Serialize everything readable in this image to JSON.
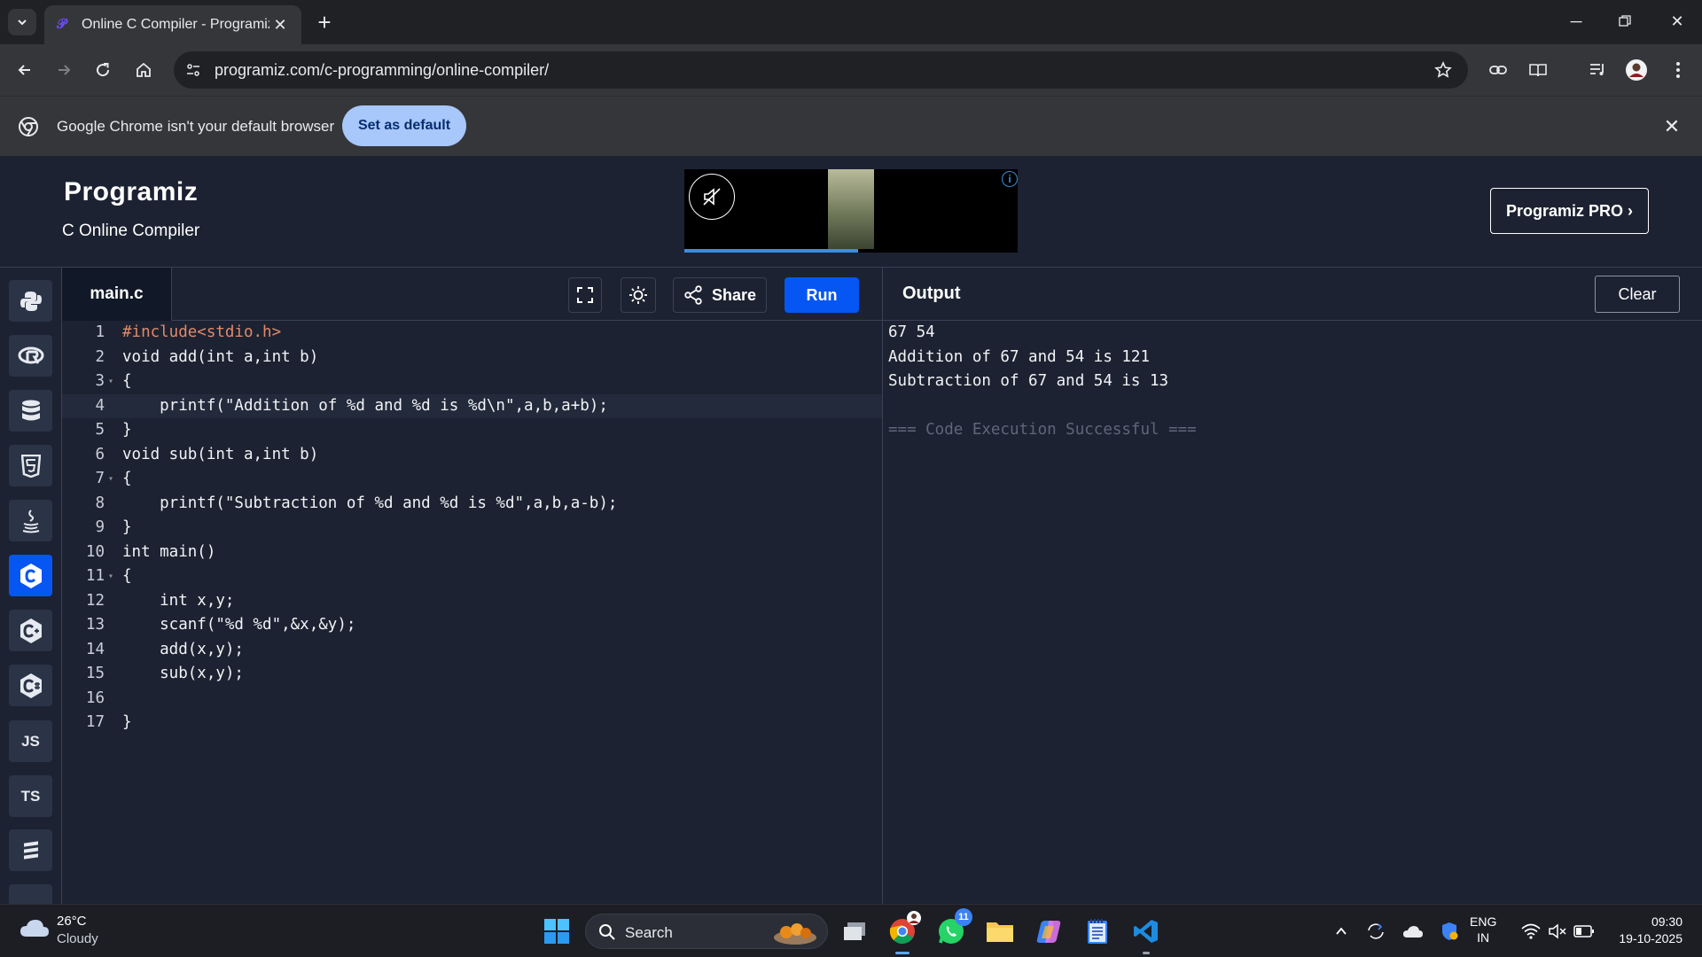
{
  "browser": {
    "tab_title": "Online C Compiler - Programiz",
    "url": "programiz.com/c-programming/online-compiler/",
    "infobar_text": "Google Chrome isn't your default browser",
    "set_default_label": "Set as default"
  },
  "site": {
    "logo": "Programiz",
    "subtitle": "C Online Compiler",
    "pro_button": "Programiz PRO ›"
  },
  "sidebar": {
    "languages": [
      {
        "name": "python",
        "label": ""
      },
      {
        "name": "r",
        "label": ""
      },
      {
        "name": "sql",
        "label": ""
      },
      {
        "name": "html",
        "label": ""
      },
      {
        "name": "java",
        "label": ""
      },
      {
        "name": "c",
        "label": "",
        "active": true
      },
      {
        "name": "cpp",
        "label": ""
      },
      {
        "name": "csharp",
        "label": ""
      },
      {
        "name": "javascript",
        "label": "JS"
      },
      {
        "name": "typescript",
        "label": "TS"
      },
      {
        "name": "more",
        "label": ""
      }
    ]
  },
  "editor": {
    "file_name": "main.c",
    "share_label": "Share",
    "run_label": "Run",
    "active_line": 4,
    "lines": [
      "#include<stdio.h>",
      "void add(int a,int b)",
      "{",
      "    printf(\"Addition of %d and %d is %d\\n\",a,b,a+b);",
      "}",
      "void sub(int a,int b)",
      "{",
      "    printf(\"Subtraction of %d and %d is %d\",a,b,a-b);",
      "}",
      "int main()",
      "{",
      "    int x,y;",
      "    scanf(\"%d %d\",&x,&y);",
      "    add(x,y);",
      "    sub(x,y);",
      "",
      "}"
    ]
  },
  "output": {
    "title": "Output",
    "clear_label": "Clear",
    "lines": [
      "67 54",
      "Addition of 67 and 54 is 121",
      "Subtraction of 67 and 54 is 13",
      "",
      "=== Code Execution Successful ==="
    ]
  },
  "taskbar": {
    "weather_temp": "26°C",
    "weather_desc": "Cloudy",
    "search_label": "Search",
    "whatsapp_badge": "11",
    "lang_line1": "ENG",
    "lang_line2": "IN",
    "time": "09:30",
    "date": "19-10-2025"
  }
}
